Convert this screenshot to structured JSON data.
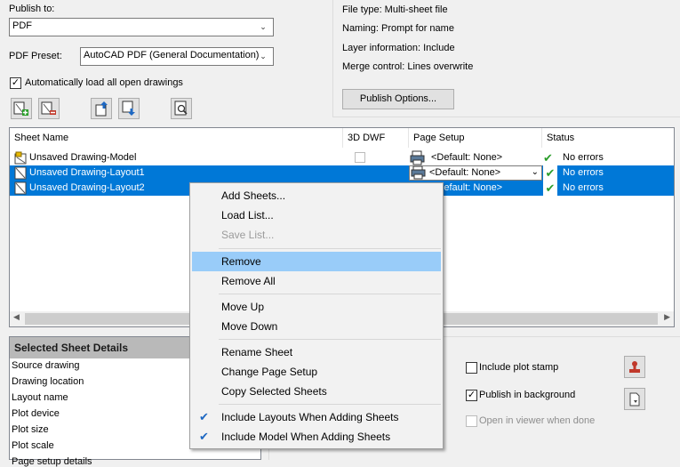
{
  "publish": {
    "publish_to_label": "Publish to:",
    "publish_to_value": "PDF",
    "preset_label": "PDF Preset:",
    "preset_value": "AutoCAD PDF (General Documentation)",
    "auto_load_label": "Automatically load all open drawings",
    "auto_load_checked": "✓"
  },
  "info": {
    "file_type": "File type: Multi-sheet file",
    "naming": "Naming: Prompt for name",
    "layer_info": "Layer information: Include",
    "merge_control": "Merge control: Lines overwrite",
    "options_button": "Publish Options..."
  },
  "list": {
    "headers": [
      "Sheet Name",
      "3D DWF",
      "Page Setup",
      "Status"
    ],
    "rows": [
      {
        "name": "Unsaved Drawing-Model",
        "page_setup": "<Default: None>",
        "status": "No errors"
      },
      {
        "name": "Unsaved Drawing-Layout1",
        "page_setup": "<Default: None>",
        "status": "No errors"
      },
      {
        "name": "Unsaved Drawing-Layout2",
        "page_setup": "<Default: None>",
        "status": "No errors"
      }
    ],
    "check_mark": "✔",
    "dropdown_arrow": "⌄"
  },
  "details": {
    "title": "Selected Sheet Details",
    "items": [
      "Source drawing",
      "Drawing location",
      "Layout name",
      "Plot device",
      "Plot size",
      "Plot scale",
      "Page setup details"
    ]
  },
  "options": {
    "plot_stamp": "Include plot stamp",
    "background": "Publish in background",
    "background_checked": "✓",
    "open_viewer": "Open in viewer when done"
  },
  "menu": {
    "items": [
      {
        "label": "Add Sheets..."
      },
      {
        "label": "Load List..."
      },
      {
        "label": "Save List..."
      },
      {
        "label": "Remove"
      },
      {
        "label": "Remove All"
      },
      {
        "label": "Move Up"
      },
      {
        "label": "Move Down"
      },
      {
        "label": "Rename Sheet"
      },
      {
        "label": "Change Page Setup"
      },
      {
        "label": "Copy Selected Sheets"
      },
      {
        "label": "Include Layouts When Adding Sheets"
      },
      {
        "label": "Include Model When Adding Sheets"
      }
    ],
    "check_glyph": "✔"
  },
  "icons": {
    "combo_arrow": "⌄"
  },
  "colors": {
    "selection": "#0078d7",
    "menu_highlight": "#99ccf9",
    "check_green": "#2a9d2a"
  }
}
